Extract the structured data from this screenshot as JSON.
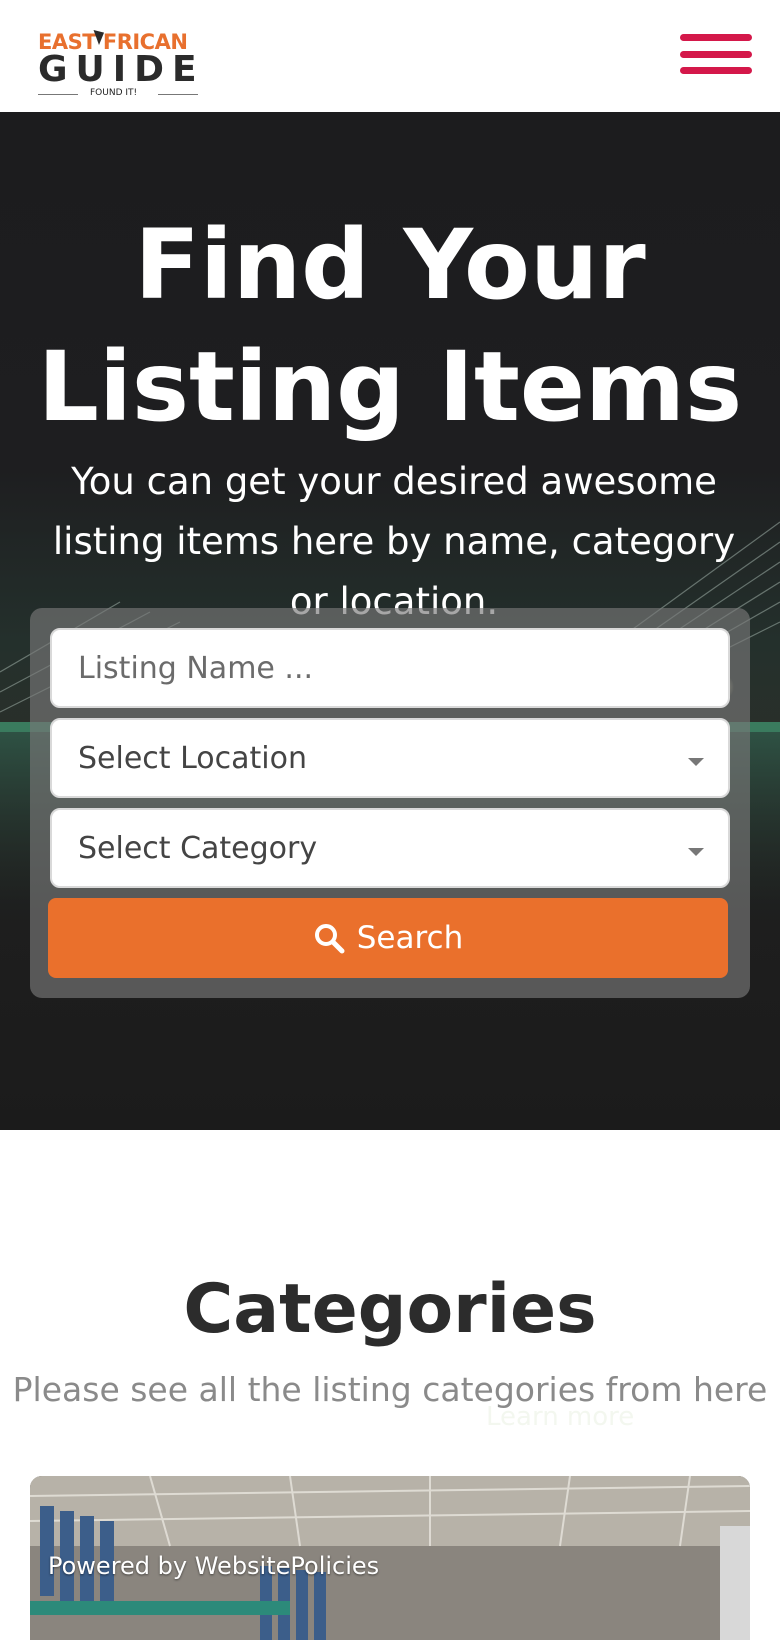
{
  "header": {
    "logo": {
      "top_text": "EAST  FRICAN",
      "main_text": "GUIDE",
      "tagline": "FOUND IT!"
    },
    "menu_icon": "hamburger-menu-icon",
    "menu_color": "#d4184a"
  },
  "hero": {
    "title_line1": "Find Your",
    "title_line2": "Listing Items",
    "subtitle": "You can get your desired awesome listing items here by name, category or location.",
    "search": {
      "name_placeholder": "Listing Name ...",
      "location_label": "Select Location",
      "category_label": "Select Category",
      "button_label": "Search",
      "button_icon": "search-icon",
      "button_color": "#ea702c"
    }
  },
  "categories": {
    "title": "Categories",
    "subtitle": "Please see all the listing categories from here",
    "learn_more": "Learn more"
  },
  "footer_overlay": {
    "powered_by": "Powered by WebsitePolicies"
  }
}
